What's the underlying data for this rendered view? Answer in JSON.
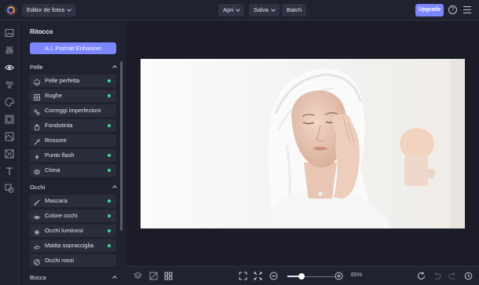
{
  "topbar": {
    "editor_label": "Editor de fotos",
    "open_label": "Apri",
    "save_label": "Salva",
    "batch_label": "Batch",
    "upgrade_label": "Upgrade",
    "help_glyph": "?"
  },
  "rail": {
    "icons": [
      "image-icon",
      "adjust-sliders-icon",
      "eye-icon",
      "effects-icon",
      "paint-icon",
      "frame-icon",
      "overlay-icon",
      "texture-icon",
      "text-icon",
      "graphics-icon"
    ]
  },
  "panel": {
    "title": "Ritocco",
    "ai_button": "A.I. Portrait Enhancer",
    "sections": [
      {
        "label": "Pelle",
        "items": [
          {
            "label": "Pelle perfetta",
            "icon": "smile-icon",
            "active": true
          },
          {
            "label": "Rughe",
            "icon": "grid-icon",
            "active": true
          },
          {
            "label": "Correggi imperfezioni",
            "icon": "blemish-icon",
            "active": false
          },
          {
            "label": "Fondotinta",
            "icon": "foundation-icon",
            "active": true
          },
          {
            "label": "Rossore",
            "icon": "pipette-icon",
            "active": false
          },
          {
            "label": "Punto flash",
            "icon": "flash-icon",
            "active": true
          },
          {
            "label": "Clona",
            "icon": "clone-icon",
            "active": true
          }
        ]
      },
      {
        "label": "Occhi",
        "items": [
          {
            "label": "Mascara",
            "icon": "brush-icon",
            "active": true
          },
          {
            "label": "Colore occhi",
            "icon": "eye-icon",
            "active": true
          },
          {
            "label": "Occhi luminosi",
            "icon": "sparkle-icon",
            "active": true
          },
          {
            "label": "Matita sopracciglia",
            "icon": "eyebrow-icon",
            "active": true
          },
          {
            "label": "Occhi rossi",
            "icon": "redeye-icon",
            "active": false
          }
        ]
      },
      {
        "label": "Bocca",
        "items": []
      }
    ]
  },
  "bottombar": {
    "zoom_percent": "65%",
    "zoom_level": 0.3
  },
  "colors": {
    "accent": "#7c86ff",
    "active_dot": "#3ddc97",
    "background": "#20222f",
    "canvas": "#1b1c27"
  }
}
